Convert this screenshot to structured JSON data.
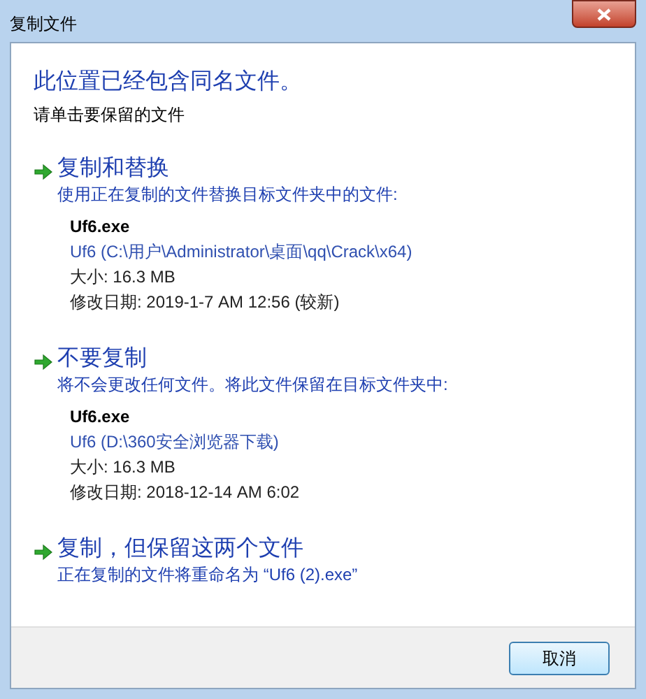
{
  "window": {
    "title": "复制文件"
  },
  "heading": "此位置已经包含同名文件。",
  "instruction": "请单击要保留的文件",
  "options": [
    {
      "title": "复制和替换",
      "description": "使用正在复制的文件替换目标文件夹中的文件:",
      "file": {
        "name": "Uf6.exe",
        "location": "Uf6 (C:\\用户\\Administrator\\桌面\\qq\\Crack\\x64)",
        "size": "大小: 16.3 MB",
        "modified": "修改日期: 2019-1-7 AM 12:56 (较新)"
      }
    },
    {
      "title": "不要复制",
      "description": "将不会更改任何文件。将此文件保留在目标文件夹中:",
      "file": {
        "name": "Uf6.exe",
        "location": "Uf6 (D:\\360安全浏览器下载)",
        "size": "大小: 16.3 MB",
        "modified": "修改日期: 2018-12-14 AM 6:02"
      }
    },
    {
      "title": "复制，但保留这两个文件",
      "description": "正在复制的文件将重命名为 “Uf6 (2).exe”"
    }
  ],
  "buttons": [
    "取消"
  ]
}
